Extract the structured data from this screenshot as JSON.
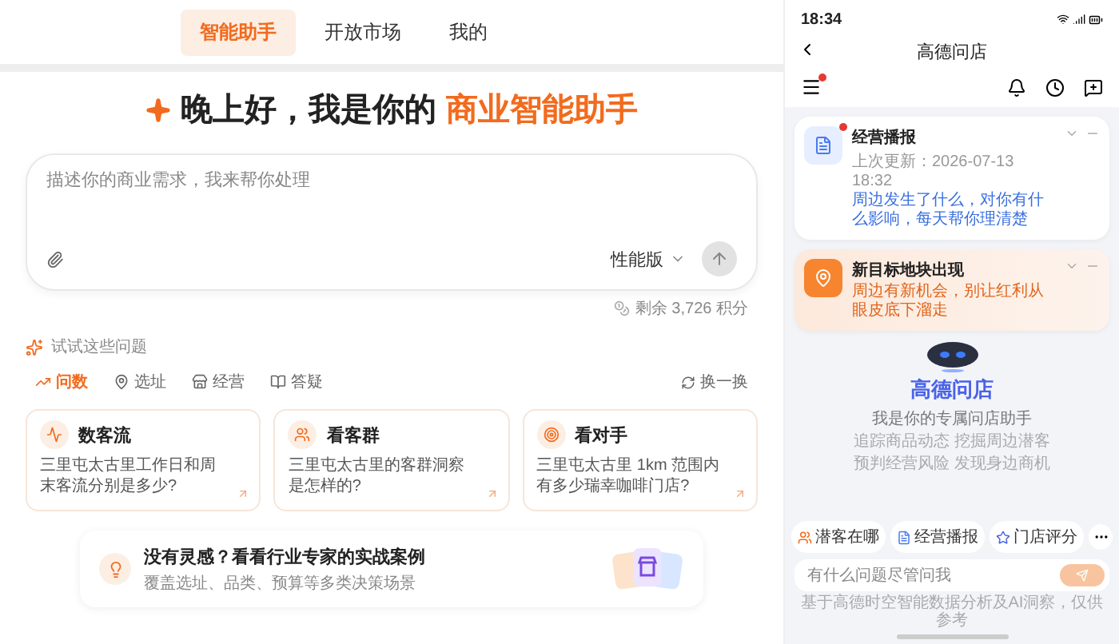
{
  "nav": {
    "tabs": [
      {
        "label": "智能助手",
        "selected": true
      },
      {
        "label": "开放市场",
        "selected": false
      },
      {
        "label": "我的",
        "selected": false
      }
    ]
  },
  "greeting": {
    "text": "晚上好，我是你的",
    "highlight": "商业智能助手"
  },
  "prompt": {
    "placeholder": "描述你的商业需求，我来帮你处理",
    "mode": "性能版"
  },
  "credits": "剩余 3,726 积分",
  "suggestions": {
    "title": "试试这些问题",
    "refresh": "换一换",
    "tabs": [
      {
        "kind": "trend",
        "label": "问数",
        "selected": true
      },
      {
        "kind": "pin",
        "label": "选址",
        "selected": false
      },
      {
        "kind": "shop",
        "label": "经营",
        "selected": false
      },
      {
        "kind": "book",
        "label": "答疑",
        "selected": false
      }
    ],
    "cards": [
      {
        "kind": "pulse",
        "title": "数客流",
        "question": "三里屯太古里工作日和周末客流分别是多少?"
      },
      {
        "kind": "people",
        "title": "看客群",
        "question": "三里屯太古里的客群洞察是怎样的?"
      },
      {
        "kind": "target",
        "title": "看对手",
        "question": "三里屯太古里 1km 范围内有多少瑞幸咖啡门店?"
      }
    ]
  },
  "banner": {
    "title": "没有灵感？看看行业专家的实战案例",
    "subtitle": "覆盖选址、品类、预算等多类决策场景"
  },
  "phone": {
    "time": "18:34",
    "title": "高德问店",
    "menu_badge": true,
    "notices": [
      {
        "kind": "report",
        "title": "经营播报",
        "meta": "上次更新：2026-07-13 18:32",
        "text": "周边发生了什么，对你有什么影响，每天帮你理清楚",
        "unread": true
      },
      {
        "kind": "location",
        "title": "新目标地块出现",
        "text": "周边有新机会，别让红利从眼皮底下溜走",
        "unread": false
      }
    ],
    "assistant_name": "高德问店",
    "intro": "我是你的专属问店助手",
    "features": [
      "追踪商品动态 挖掘周边潜客",
      "预判经营风险 发现身边商机"
    ],
    "chips": [
      {
        "kind": "people",
        "label": "潜客在哪"
      },
      {
        "kind": "report",
        "label": "经营播报"
      },
      {
        "kind": "star",
        "label": "门店评分"
      }
    ],
    "input_placeholder": "有什么问题尽管问我",
    "footer": "基于高德时空智能数据分析及AI洞察，仅供参考"
  }
}
